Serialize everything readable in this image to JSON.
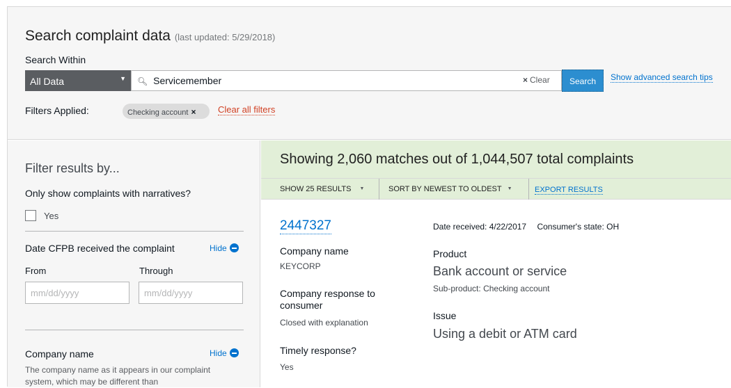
{
  "header": {
    "title": "Search complaint data",
    "last_updated": "(last updated: 5/29/2018)"
  },
  "search": {
    "within_label": "Search Within",
    "scope_value": "All Data",
    "query": "Servicemember",
    "clear_label": "Clear",
    "search_button": "Search",
    "advanced_tips": "Show advanced search tips"
  },
  "filters_applied": {
    "label": "Filters Applied:",
    "pills": [
      {
        "label": "Checking account"
      }
    ],
    "clear_all": "Clear all filters"
  },
  "sidebar": {
    "title": "Filter results by...",
    "narratives_question": "Only show complaints with narratives?",
    "narratives_yes": "Yes",
    "date_section": {
      "title": "Date CFPB received the complaint",
      "hide": "Hide",
      "from_label": "From",
      "through_label": "Through",
      "from_placeholder": "mm/dd/yyyy",
      "through_placeholder": "mm/dd/yyyy"
    },
    "company_section": {
      "title": "Company name",
      "hide": "Hide",
      "description": "The company name as it appears in our complaint system, which may be different than"
    }
  },
  "results": {
    "summary": "Showing 2,060 matches out of 1,044,507 total complaints",
    "toolbar": {
      "show": "SHOW 25 RESULTS",
      "sort": "SORT BY NEWEST TO OLDEST",
      "export": "EXPORT RESULTS"
    },
    "complaint": {
      "id": "2447327",
      "date_received_label": "Date received:",
      "date_received": "4/22/2017",
      "state_label": "Consumer's state:",
      "state": "OH",
      "company_label": "Company name",
      "company": "KEYCORP",
      "response_label": "Company response to consumer",
      "response": "Closed with explanation",
      "timely_label": "Timely response?",
      "timely": "Yes",
      "product_label": "Product",
      "product": "Bank account or service",
      "subproduct_label": "Sub-product:",
      "subproduct": "Checking account",
      "issue_label": "Issue",
      "issue": "Using a debit or ATM card"
    }
  },
  "colors": {
    "accent": "#0072ce",
    "search_button": "#2c8ed0",
    "clear_all": "#d14124",
    "results_bg": "#e2efd8",
    "panel_bg": "#f6f6f6"
  }
}
